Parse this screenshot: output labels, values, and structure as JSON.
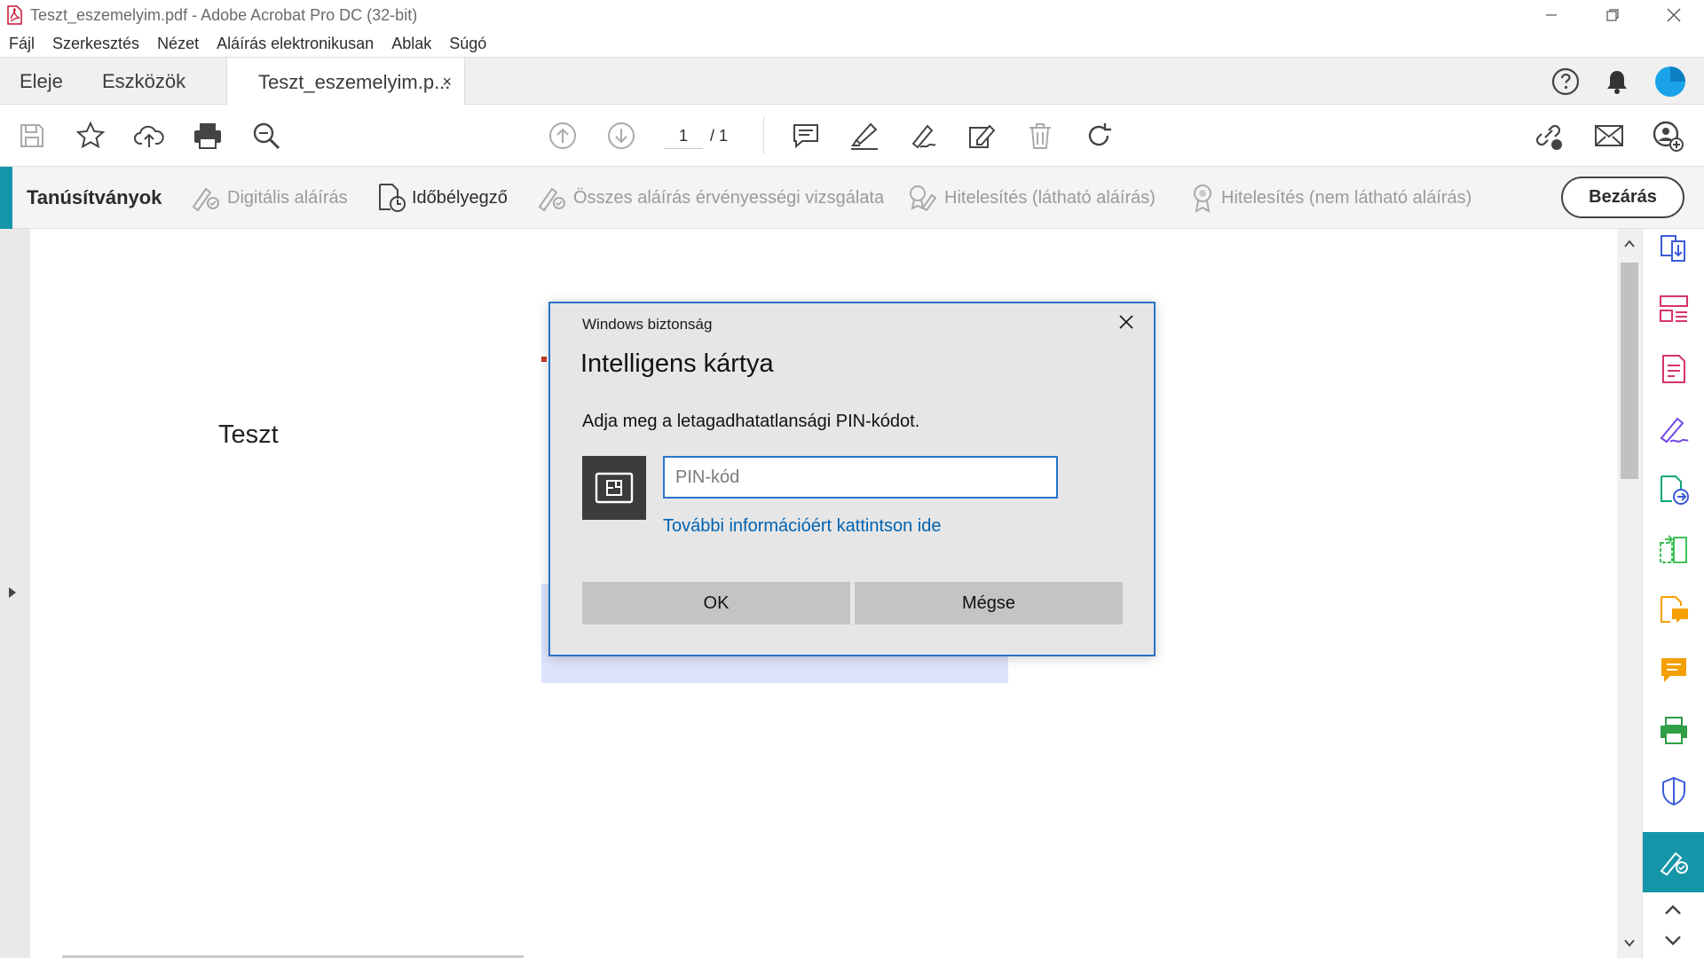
{
  "window": {
    "title": "Teszt_eszemelyim.pdf - Adobe Acrobat Pro DC (32-bit)"
  },
  "menu": {
    "items": [
      "Fájl",
      "Szerkesztés",
      "Nézet",
      "Aláírás elektronikusan",
      "Ablak",
      "Súgó"
    ]
  },
  "tabs": {
    "home": "Eleje",
    "tools": "Eszközök",
    "document": "Teszt_eszemelyim.p...",
    "close": "×"
  },
  "toolbar": {
    "page_current": "1",
    "page_total": "/ 1"
  },
  "certificates": {
    "title": "Tanúsítványok",
    "digital_sign": "Digitális aláírás",
    "timestamp": "Időbélyegző",
    "validate_all": "Összes aláírás érvényességi vizsgálata",
    "certify_visible": "Hitelesítés (látható aláírás)",
    "certify_invisible": "Hitelesítés (nem látható aláírás)",
    "close": "Bezárás"
  },
  "document": {
    "text": "Teszt"
  },
  "dialog": {
    "caption": "Windows biztonság",
    "title": "Intelligens kártya",
    "prompt": "Adja meg a letagadhatatlansági PIN-kódot.",
    "pin_placeholder": "PIN-kód",
    "pin_value": "",
    "link": "További információért kattintson ide",
    "ok": "OK",
    "cancel": "Mégse"
  },
  "colors": {
    "accent": "#1496a8",
    "dialog_border": "#2b73c7",
    "link": "#0063b1",
    "signature_field": "#dde3fb"
  }
}
